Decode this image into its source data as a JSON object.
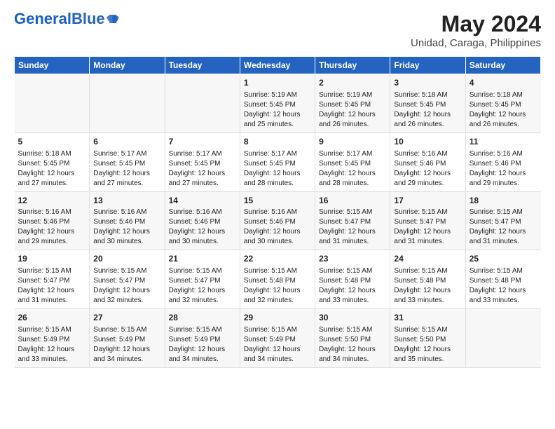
{
  "header": {
    "logo_general": "General",
    "logo_blue": "Blue",
    "main_title": "May 2024",
    "subtitle": "Unidad, Caraga, Philippines"
  },
  "days_of_week": [
    "Sunday",
    "Monday",
    "Tuesday",
    "Wednesday",
    "Thursday",
    "Friday",
    "Saturday"
  ],
  "weeks": [
    [
      {
        "day": "",
        "info": ""
      },
      {
        "day": "",
        "info": ""
      },
      {
        "day": "",
        "info": ""
      },
      {
        "day": "1",
        "info": "Sunrise: 5:19 AM\nSunset: 5:45 PM\nDaylight: 12 hours and 25 minutes."
      },
      {
        "day": "2",
        "info": "Sunrise: 5:19 AM\nSunset: 5:45 PM\nDaylight: 12 hours and 26 minutes."
      },
      {
        "day": "3",
        "info": "Sunrise: 5:18 AM\nSunset: 5:45 PM\nDaylight: 12 hours and 26 minutes."
      },
      {
        "day": "4",
        "info": "Sunrise: 5:18 AM\nSunset: 5:45 PM\nDaylight: 12 hours and 26 minutes."
      }
    ],
    [
      {
        "day": "5",
        "info": "Sunrise: 5:18 AM\nSunset: 5:45 PM\nDaylight: 12 hours and 27 minutes."
      },
      {
        "day": "6",
        "info": "Sunrise: 5:17 AM\nSunset: 5:45 PM\nDaylight: 12 hours and 27 minutes."
      },
      {
        "day": "7",
        "info": "Sunrise: 5:17 AM\nSunset: 5:45 PM\nDaylight: 12 hours and 27 minutes."
      },
      {
        "day": "8",
        "info": "Sunrise: 5:17 AM\nSunset: 5:45 PM\nDaylight: 12 hours and 28 minutes."
      },
      {
        "day": "9",
        "info": "Sunrise: 5:17 AM\nSunset: 5:45 PM\nDaylight: 12 hours and 28 minutes."
      },
      {
        "day": "10",
        "info": "Sunrise: 5:16 AM\nSunset: 5:46 PM\nDaylight: 12 hours and 29 minutes."
      },
      {
        "day": "11",
        "info": "Sunrise: 5:16 AM\nSunset: 5:46 PM\nDaylight: 12 hours and 29 minutes."
      }
    ],
    [
      {
        "day": "12",
        "info": "Sunrise: 5:16 AM\nSunset: 5:46 PM\nDaylight: 12 hours and 29 minutes."
      },
      {
        "day": "13",
        "info": "Sunrise: 5:16 AM\nSunset: 5:46 PM\nDaylight: 12 hours and 30 minutes."
      },
      {
        "day": "14",
        "info": "Sunrise: 5:16 AM\nSunset: 5:46 PM\nDaylight: 12 hours and 30 minutes."
      },
      {
        "day": "15",
        "info": "Sunrise: 5:16 AM\nSunset: 5:46 PM\nDaylight: 12 hours and 30 minutes."
      },
      {
        "day": "16",
        "info": "Sunrise: 5:15 AM\nSunset: 5:47 PM\nDaylight: 12 hours and 31 minutes."
      },
      {
        "day": "17",
        "info": "Sunrise: 5:15 AM\nSunset: 5:47 PM\nDaylight: 12 hours and 31 minutes."
      },
      {
        "day": "18",
        "info": "Sunrise: 5:15 AM\nSunset: 5:47 PM\nDaylight: 12 hours and 31 minutes."
      }
    ],
    [
      {
        "day": "19",
        "info": "Sunrise: 5:15 AM\nSunset: 5:47 PM\nDaylight: 12 hours and 31 minutes."
      },
      {
        "day": "20",
        "info": "Sunrise: 5:15 AM\nSunset: 5:47 PM\nDaylight: 12 hours and 32 minutes."
      },
      {
        "day": "21",
        "info": "Sunrise: 5:15 AM\nSunset: 5:47 PM\nDaylight: 12 hours and 32 minutes."
      },
      {
        "day": "22",
        "info": "Sunrise: 5:15 AM\nSunset: 5:48 PM\nDaylight: 12 hours and 32 minutes."
      },
      {
        "day": "23",
        "info": "Sunrise: 5:15 AM\nSunset: 5:48 PM\nDaylight: 12 hours and 33 minutes."
      },
      {
        "day": "24",
        "info": "Sunrise: 5:15 AM\nSunset: 5:48 PM\nDaylight: 12 hours and 33 minutes."
      },
      {
        "day": "25",
        "info": "Sunrise: 5:15 AM\nSunset: 5:48 PM\nDaylight: 12 hours and 33 minutes."
      }
    ],
    [
      {
        "day": "26",
        "info": "Sunrise: 5:15 AM\nSunset: 5:49 PM\nDaylight: 12 hours and 33 minutes."
      },
      {
        "day": "27",
        "info": "Sunrise: 5:15 AM\nSunset: 5:49 PM\nDaylight: 12 hours and 34 minutes."
      },
      {
        "day": "28",
        "info": "Sunrise: 5:15 AM\nSunset: 5:49 PM\nDaylight: 12 hours and 34 minutes."
      },
      {
        "day": "29",
        "info": "Sunrise: 5:15 AM\nSunset: 5:49 PM\nDaylight: 12 hours and 34 minutes."
      },
      {
        "day": "30",
        "info": "Sunrise: 5:15 AM\nSunset: 5:50 PM\nDaylight: 12 hours and 34 minutes."
      },
      {
        "day": "31",
        "info": "Sunrise: 5:15 AM\nSunset: 5:50 PM\nDaylight: 12 hours and 35 minutes."
      },
      {
        "day": "",
        "info": ""
      }
    ]
  ]
}
